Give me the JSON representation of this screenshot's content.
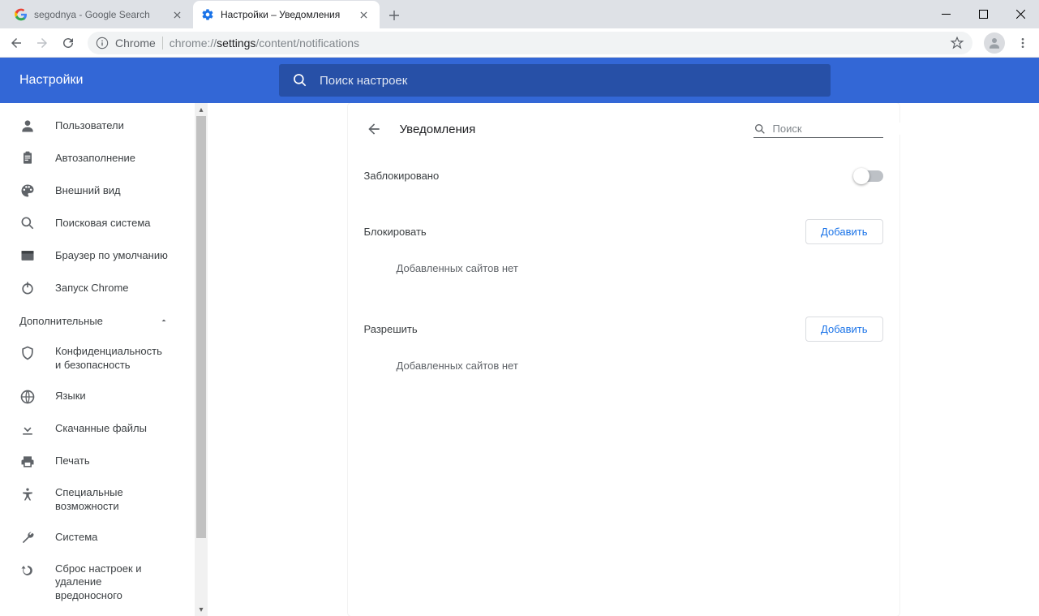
{
  "tabs": [
    {
      "title": "segodnya - Google Search"
    },
    {
      "title": "Настройки – Уведомления"
    }
  ],
  "url": {
    "origin_label": "Chrome",
    "scheme": "chrome://",
    "highlight": "settings",
    "rest": "/content/notifications"
  },
  "header": {
    "title": "Настройки",
    "search_placeholder": "Поиск настроек"
  },
  "sidebar": {
    "items": [
      {
        "label": "Пользователи"
      },
      {
        "label": "Автозаполнение"
      },
      {
        "label": "Внешний вид"
      },
      {
        "label": "Поисковая система"
      },
      {
        "label": "Браузер по умолчанию"
      },
      {
        "label": "Запуск Chrome"
      }
    ],
    "section_label": "Дополнительные",
    "extra_items": [
      {
        "label": "Конфиденциальность и безопасность"
      },
      {
        "label": "Языки"
      },
      {
        "label": "Скачанные файлы"
      },
      {
        "label": "Печать"
      },
      {
        "label": "Специальные возможности"
      },
      {
        "label": "Система"
      },
      {
        "label": "Сброс настроек и удаление вредоносного"
      }
    ]
  },
  "page": {
    "title": "Уведомления",
    "search_placeholder": "Поиск",
    "blocked_label": "Заблокировано",
    "sections": [
      {
        "title": "Блокировать",
        "add_label": "Добавить",
        "empty": "Добавленных сайтов нет"
      },
      {
        "title": "Разрешить",
        "add_label": "Добавить",
        "empty": "Добавленных сайтов нет"
      }
    ]
  }
}
